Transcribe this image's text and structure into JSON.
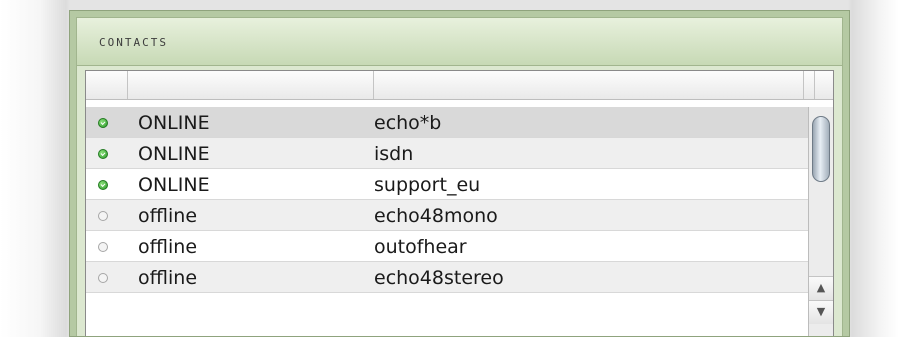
{
  "panel": {
    "title": "CONTACTS"
  },
  "contacts": [
    {
      "status": "ONLINE",
      "name": "echo*b",
      "online": true,
      "selected": true
    },
    {
      "status": "ONLINE",
      "name": "isdn",
      "online": true
    },
    {
      "status": "ONLINE",
      "name": "support_eu",
      "online": true
    },
    {
      "status": "offline",
      "name": "echo48mono",
      "online": false
    },
    {
      "status": "offline",
      "name": "outofhear",
      "online": false
    },
    {
      "status": "offline",
      "name": "echo48stereo",
      "online": false
    }
  ],
  "scrollbar": {
    "up_glyph": "▲",
    "down_glyph": "▼"
  },
  "colors": {
    "panel_green": "#b5c9a3",
    "online_green": "#2c9a2a",
    "selected_row": "#d9d9d9"
  }
}
